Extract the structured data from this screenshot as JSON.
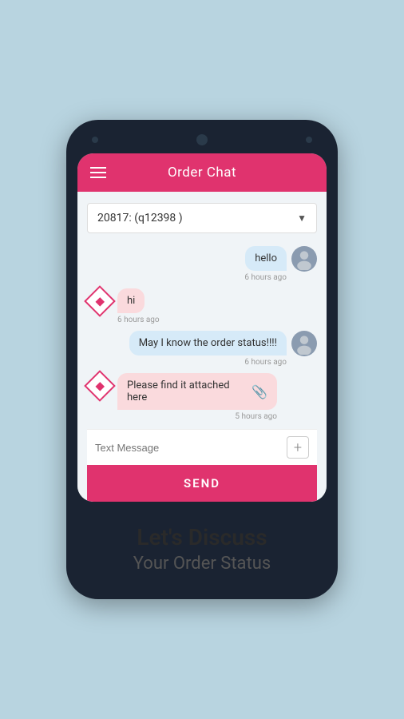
{
  "header": {
    "title": "Order Chat",
    "menu_icon": "hamburger-icon"
  },
  "dropdown": {
    "label": "20817: (q12398 )",
    "arrow": "▼"
  },
  "messages": [
    {
      "id": "msg1",
      "type": "right",
      "text": "hello",
      "time": "6 hours ago",
      "avatar_type": "person"
    },
    {
      "id": "msg2",
      "type": "left",
      "text": "hi",
      "time": "6 hours ago",
      "avatar_type": "diamond"
    },
    {
      "id": "msg3",
      "type": "right",
      "text": "May I know the order status!!!!",
      "time": "6 hours ago",
      "avatar_type": "person"
    },
    {
      "id": "msg4",
      "type": "left",
      "text": "Please find it attached here",
      "time": "5 hours ago",
      "avatar_type": "diamond",
      "has_attachment": true
    }
  ],
  "input": {
    "placeholder": "Text Message",
    "plus_label": "+"
  },
  "send_button": {
    "label": "SEND"
  },
  "bottom": {
    "heading": "Let's Discuss",
    "subheading": "Your Order Status"
  }
}
